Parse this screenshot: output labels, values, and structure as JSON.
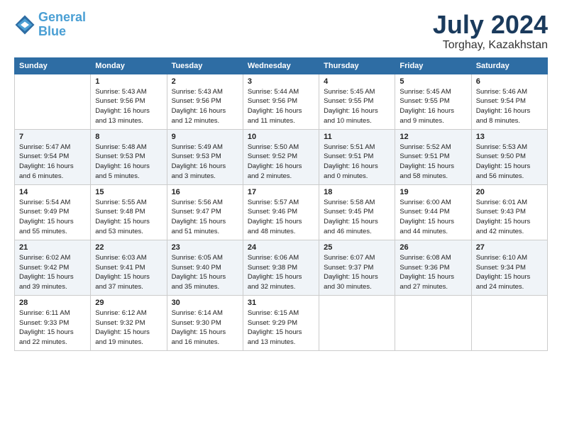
{
  "header": {
    "logo_line1": "General",
    "logo_line2": "Blue",
    "month": "July 2024",
    "location": "Torghay, Kazakhstan"
  },
  "weekdays": [
    "Sunday",
    "Monday",
    "Tuesday",
    "Wednesday",
    "Thursday",
    "Friday",
    "Saturday"
  ],
  "weeks": [
    [
      {
        "day": "",
        "info": ""
      },
      {
        "day": "1",
        "info": "Sunrise: 5:43 AM\nSunset: 9:56 PM\nDaylight: 16 hours\nand 13 minutes."
      },
      {
        "day": "2",
        "info": "Sunrise: 5:43 AM\nSunset: 9:56 PM\nDaylight: 16 hours\nand 12 minutes."
      },
      {
        "day": "3",
        "info": "Sunrise: 5:44 AM\nSunset: 9:56 PM\nDaylight: 16 hours\nand 11 minutes."
      },
      {
        "day": "4",
        "info": "Sunrise: 5:45 AM\nSunset: 9:55 PM\nDaylight: 16 hours\nand 10 minutes."
      },
      {
        "day": "5",
        "info": "Sunrise: 5:45 AM\nSunset: 9:55 PM\nDaylight: 16 hours\nand 9 minutes."
      },
      {
        "day": "6",
        "info": "Sunrise: 5:46 AM\nSunset: 9:54 PM\nDaylight: 16 hours\nand 8 minutes."
      }
    ],
    [
      {
        "day": "7",
        "info": "Sunrise: 5:47 AM\nSunset: 9:54 PM\nDaylight: 16 hours\nand 6 minutes."
      },
      {
        "day": "8",
        "info": "Sunrise: 5:48 AM\nSunset: 9:53 PM\nDaylight: 16 hours\nand 5 minutes."
      },
      {
        "day": "9",
        "info": "Sunrise: 5:49 AM\nSunset: 9:53 PM\nDaylight: 16 hours\nand 3 minutes."
      },
      {
        "day": "10",
        "info": "Sunrise: 5:50 AM\nSunset: 9:52 PM\nDaylight: 16 hours\nand 2 minutes."
      },
      {
        "day": "11",
        "info": "Sunrise: 5:51 AM\nSunset: 9:51 PM\nDaylight: 16 hours\nand 0 minutes."
      },
      {
        "day": "12",
        "info": "Sunrise: 5:52 AM\nSunset: 9:51 PM\nDaylight: 15 hours\nand 58 minutes."
      },
      {
        "day": "13",
        "info": "Sunrise: 5:53 AM\nSunset: 9:50 PM\nDaylight: 15 hours\nand 56 minutes."
      }
    ],
    [
      {
        "day": "14",
        "info": "Sunrise: 5:54 AM\nSunset: 9:49 PM\nDaylight: 15 hours\nand 55 minutes."
      },
      {
        "day": "15",
        "info": "Sunrise: 5:55 AM\nSunset: 9:48 PM\nDaylight: 15 hours\nand 53 minutes."
      },
      {
        "day": "16",
        "info": "Sunrise: 5:56 AM\nSunset: 9:47 PM\nDaylight: 15 hours\nand 51 minutes."
      },
      {
        "day": "17",
        "info": "Sunrise: 5:57 AM\nSunset: 9:46 PM\nDaylight: 15 hours\nand 48 minutes."
      },
      {
        "day": "18",
        "info": "Sunrise: 5:58 AM\nSunset: 9:45 PM\nDaylight: 15 hours\nand 46 minutes."
      },
      {
        "day": "19",
        "info": "Sunrise: 6:00 AM\nSunset: 9:44 PM\nDaylight: 15 hours\nand 44 minutes."
      },
      {
        "day": "20",
        "info": "Sunrise: 6:01 AM\nSunset: 9:43 PM\nDaylight: 15 hours\nand 42 minutes."
      }
    ],
    [
      {
        "day": "21",
        "info": "Sunrise: 6:02 AM\nSunset: 9:42 PM\nDaylight: 15 hours\nand 39 minutes."
      },
      {
        "day": "22",
        "info": "Sunrise: 6:03 AM\nSunset: 9:41 PM\nDaylight: 15 hours\nand 37 minutes."
      },
      {
        "day": "23",
        "info": "Sunrise: 6:05 AM\nSunset: 9:40 PM\nDaylight: 15 hours\nand 35 minutes."
      },
      {
        "day": "24",
        "info": "Sunrise: 6:06 AM\nSunset: 9:38 PM\nDaylight: 15 hours\nand 32 minutes."
      },
      {
        "day": "25",
        "info": "Sunrise: 6:07 AM\nSunset: 9:37 PM\nDaylight: 15 hours\nand 30 minutes."
      },
      {
        "day": "26",
        "info": "Sunrise: 6:08 AM\nSunset: 9:36 PM\nDaylight: 15 hours\nand 27 minutes."
      },
      {
        "day": "27",
        "info": "Sunrise: 6:10 AM\nSunset: 9:34 PM\nDaylight: 15 hours\nand 24 minutes."
      }
    ],
    [
      {
        "day": "28",
        "info": "Sunrise: 6:11 AM\nSunset: 9:33 PM\nDaylight: 15 hours\nand 22 minutes."
      },
      {
        "day": "29",
        "info": "Sunrise: 6:12 AM\nSunset: 9:32 PM\nDaylight: 15 hours\nand 19 minutes."
      },
      {
        "day": "30",
        "info": "Sunrise: 6:14 AM\nSunset: 9:30 PM\nDaylight: 15 hours\nand 16 minutes."
      },
      {
        "day": "31",
        "info": "Sunrise: 6:15 AM\nSunset: 9:29 PM\nDaylight: 15 hours\nand 13 minutes."
      },
      {
        "day": "",
        "info": ""
      },
      {
        "day": "",
        "info": ""
      },
      {
        "day": "",
        "info": ""
      }
    ]
  ]
}
